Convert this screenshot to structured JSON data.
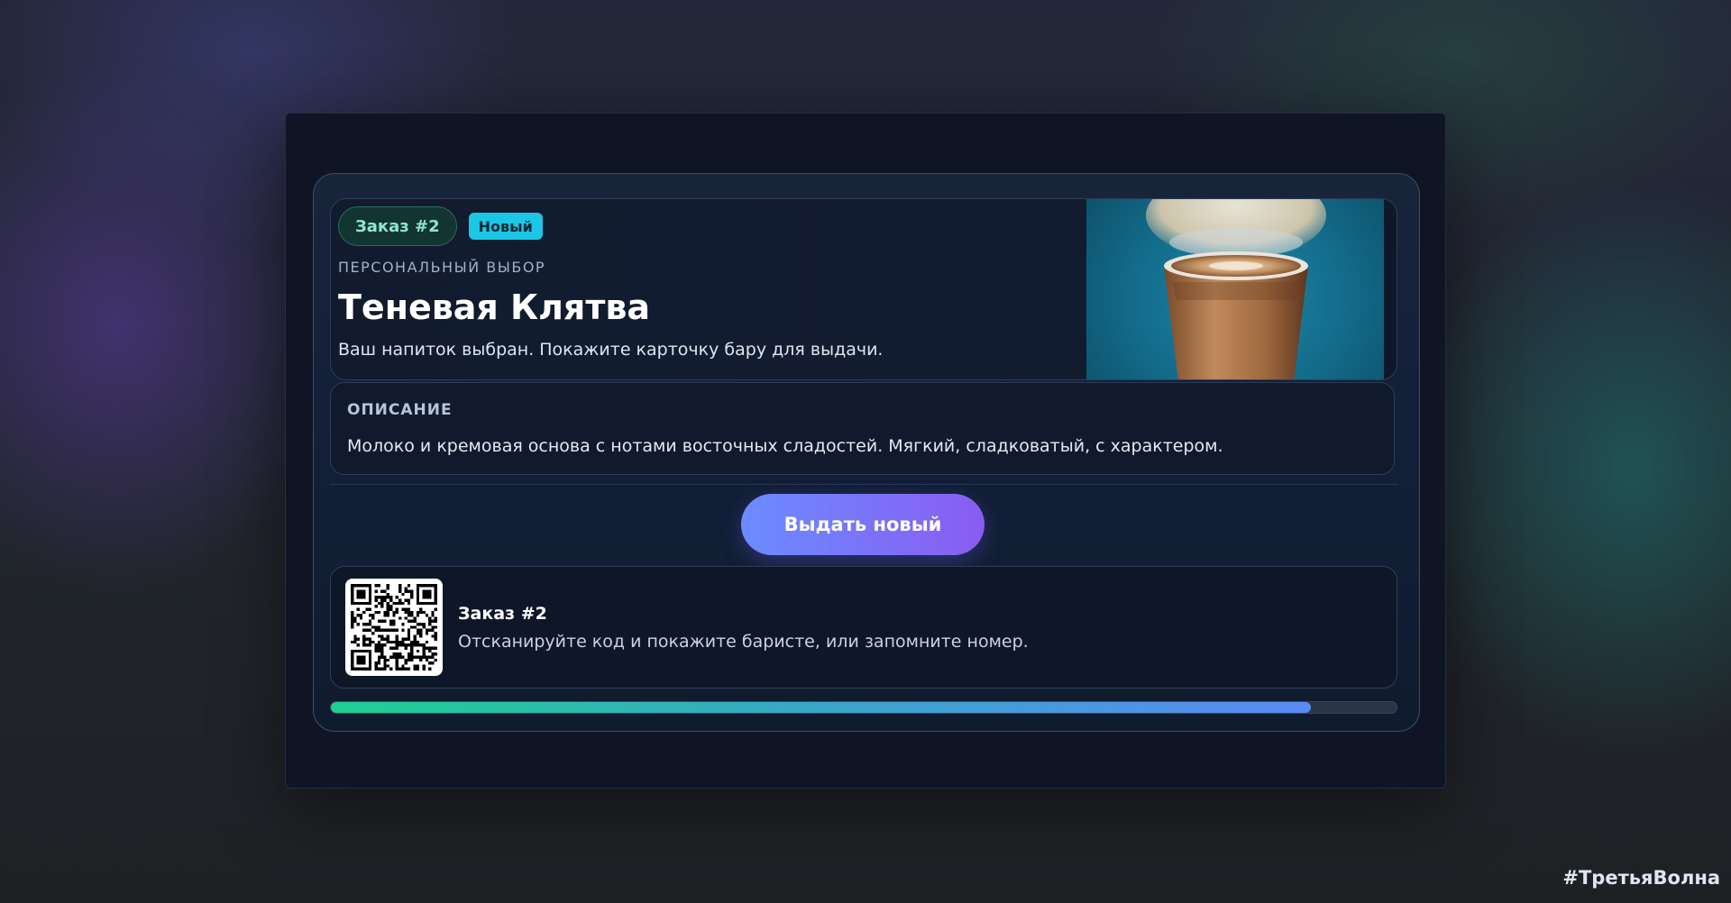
{
  "order_card": {
    "order_label": "Заказ #2",
    "status_badge": "Новый",
    "kicker": "ПЕРСОНАЛЬНЫЙ ВЫБОР",
    "drink_name": "Теневая Клятва",
    "subtitle": "Ваш напиток выбран. Покажите карточку бару для выдачи.",
    "photo_icon": "coffee-cup-image"
  },
  "description": {
    "label": "ОПИСАНИЕ",
    "text": "Молоко и кремовая основа с нотами восточных сладостей. Мягкий, сладковатый, с характером."
  },
  "actions": {
    "issue_new_label": "Выдать новый"
  },
  "qr": {
    "icon": "qr-code",
    "title": "Заказ #2",
    "text": "Отсканируйте код и покажите баристе, или запомните номер."
  },
  "progress": {
    "value_percent": 92
  },
  "footer": {
    "hashtag": "#ТретьяВолна"
  },
  "colors": {
    "accent_start": "#6b8cff",
    "accent_end": "#8a5cf2",
    "badge_new": "#1bc6e6",
    "order_pill_text": "#8fe6cf",
    "progress_start": "#1fcf92",
    "progress_end": "#5a8af5"
  }
}
